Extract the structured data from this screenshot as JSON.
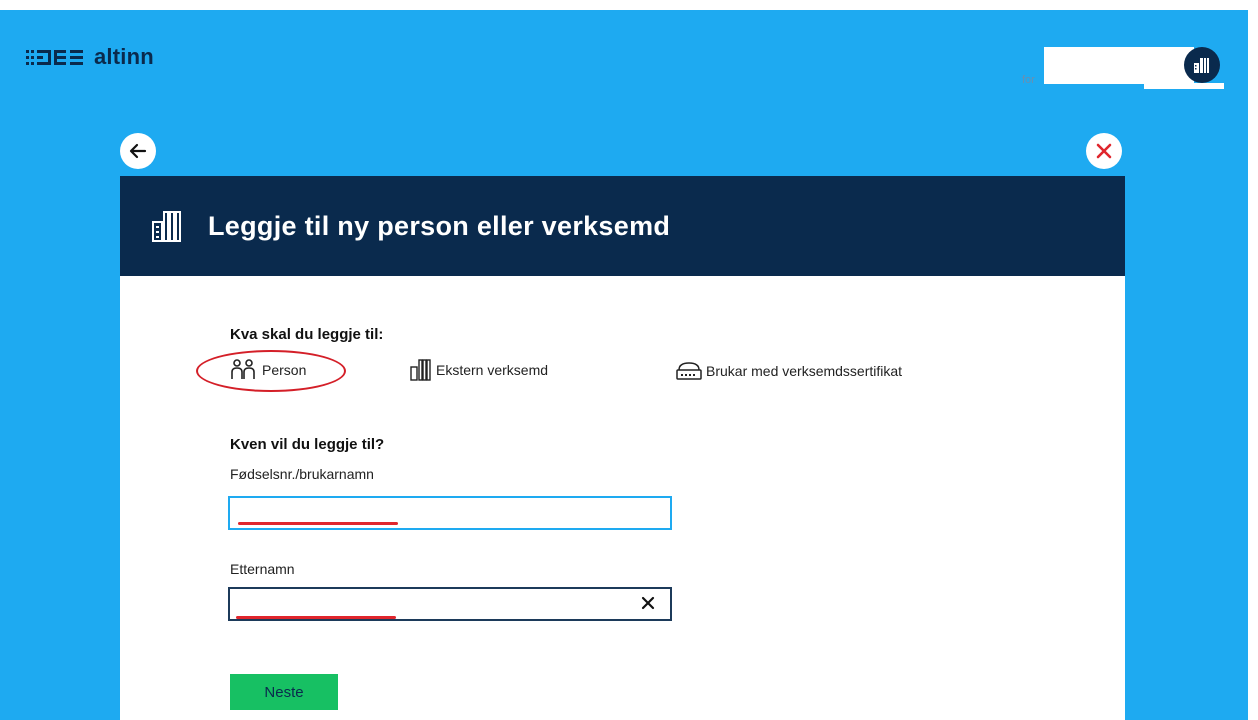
{
  "header": {
    "logo_text": "altinn",
    "for_label": "for"
  },
  "dialog": {
    "title": "Leggje til ny person eller verksemd",
    "type_question": "Kva skal du leggje til:",
    "type_options": [
      {
        "label": "Person",
        "icon": "person-icon",
        "selected": true
      },
      {
        "label": "Ekstern verksemd",
        "icon": "building-icon",
        "selected": false
      },
      {
        "label": "Brukar med verksemdssertifikat",
        "icon": "certificate-icon",
        "selected": false
      }
    ],
    "who_question": "Kven vil du leggje til?",
    "fields": {
      "ssn_label": "Fødselsnr./brukarnamn",
      "ssn_value": "",
      "lastname_label": "Etternamn",
      "lastname_value": ""
    },
    "next_label": "Neste"
  },
  "colors": {
    "background": "#1eaaf1",
    "header": "#0a2a4d",
    "primary_button": "#17c063",
    "highlight": "#d41f28"
  }
}
